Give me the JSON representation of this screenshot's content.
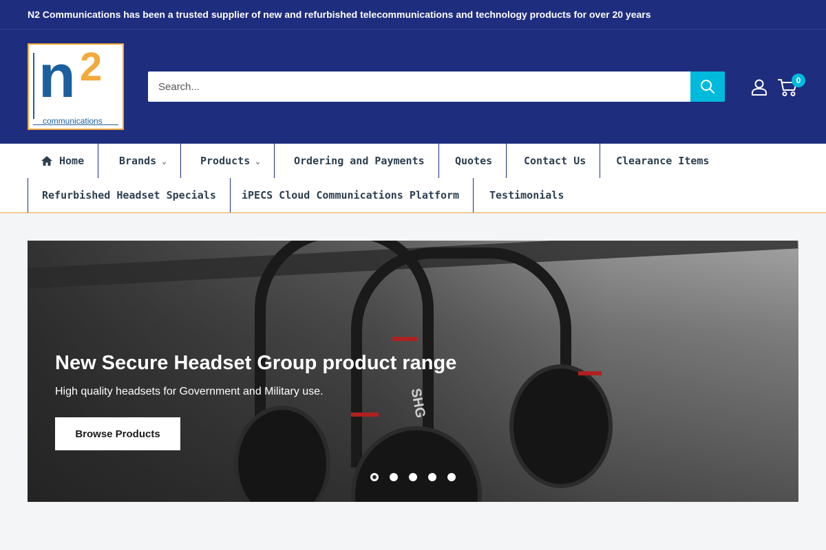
{
  "announcement": "N2 Communications has been a trusted supplier of new and refurbished telecommunications and technology products for over 20 years",
  "logo": {
    "mark_n": "n",
    "mark_2": "2",
    "wordmark": "communications"
  },
  "search": {
    "placeholder": "Search..."
  },
  "cart": {
    "count": "0"
  },
  "nav": {
    "items": [
      {
        "label": "Home",
        "icon": "home-icon"
      },
      {
        "label": "Brands",
        "dropdown": true
      },
      {
        "label": "Products",
        "dropdown": true
      },
      {
        "label": "Ordering and Payments"
      },
      {
        "label": "Quotes"
      },
      {
        "label": "Contact Us"
      },
      {
        "label": "Clearance Items"
      },
      {
        "label": "Refurbished Headset Specials"
      },
      {
        "label": "iPECS Cloud Communications Platform"
      },
      {
        "label": "Testimonials"
      }
    ],
    "dropdown_glyph": "⌄"
  },
  "hero": {
    "title": "New Secure Headset Group product range",
    "subtitle": "High quality headsets for Government and Military use.",
    "button_label": "Browse Products",
    "image_text": "SHG",
    "slides": 5,
    "active_slide": 1
  },
  "colors": {
    "primary": "#1e2d7d",
    "accent": "#00badb",
    "nav_border": "#e8a43a",
    "background": "#f3f5f7"
  }
}
